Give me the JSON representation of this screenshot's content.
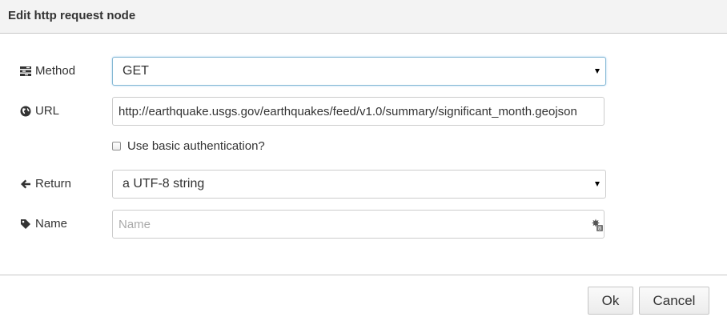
{
  "dialog": {
    "title": "Edit http request node"
  },
  "fields": {
    "method": {
      "label": "Method",
      "icon": "tasks-icon",
      "value": "GET"
    },
    "url": {
      "label": "URL",
      "icon": "globe-icon",
      "value": "http://earthquake.usgs.gov/earthquakes/feed/v1.0/summary/significant_month.geojson"
    },
    "basic_auth": {
      "label": "Use basic authentication?",
      "checked": false
    },
    "return": {
      "label": "Return",
      "icon": "arrow-left-icon",
      "value": "a UTF-8 string"
    },
    "name": {
      "label": "Name",
      "icon": "tag-icon",
      "value": "",
      "placeholder": "Name"
    }
  },
  "buttons": {
    "ok": "Ok",
    "cancel": "Cancel"
  },
  "colors": {
    "titlebar": "#f3f3f3",
    "focus_border": "#85b8d4",
    "border": "#cccccc"
  }
}
